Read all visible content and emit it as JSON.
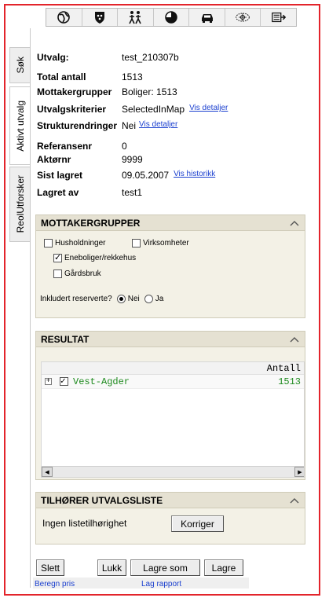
{
  "toolbar": {
    "icons": [
      "globe-icon",
      "shield-icon",
      "people-icon",
      "pie-chart-icon",
      "car-icon",
      "map-target-icon",
      "export-icon"
    ]
  },
  "tabs": [
    {
      "label": "Søk",
      "active": false
    },
    {
      "label": "Aktivt utvalg",
      "active": true
    },
    {
      "label": "ReolUtforsker",
      "active": false
    }
  ],
  "info": {
    "utvalg_label": "Utvalg:",
    "utvalg_value": "test_210307b",
    "total_label": "Total antall",
    "total_value": "1513",
    "mottaker_label": "Mottakergrupper",
    "mottaker_value": "Boliger: 1513",
    "kriterier_label": "Utvalgskriterier",
    "kriterier_value": "SelectedInMap",
    "kriterier_link": "Vis detaljer",
    "struktur_label": "Strukturendringer",
    "struktur_value": "Nei",
    "struktur_link": "Vis detaljer",
    "ref_label": "Referansenr",
    "ref_value": "0",
    "aktor_label": "Aktørnr",
    "aktor_value": "9999",
    "lagret_label": "Sist lagret",
    "lagret_value": "09.05.2007",
    "lagret_link": "Vis historikk",
    "lagretav_label": "Lagret av",
    "lagretav_value": "test1"
  },
  "mottakergrupper": {
    "title": "MOTTAKERGRUPPER",
    "husholdninger": {
      "label": "Husholdninger",
      "checked": false
    },
    "virksomheter": {
      "label": "Virksomheter",
      "checked": false
    },
    "eneboliger": {
      "label": "Eneboliger/rekkehus",
      "checked": true
    },
    "gardsbruk": {
      "label": "Gårdsbruk",
      "checked": false
    },
    "reserverte_label": "Inkludert reserverte?",
    "nei_label": "Nei",
    "ja_label": "Ja",
    "selected": "Nei"
  },
  "resultat": {
    "title": "RESULTAT",
    "column_header": "Antall",
    "rows": [
      {
        "name": "Vest-Agder",
        "count": "1513",
        "checked": true
      }
    ],
    "row_color": "#1e8a1e"
  },
  "utvalgsliste": {
    "title": "TILHØRER UTVALGSLISTE",
    "text": "Ingen listetilhørighet",
    "button": "Korriger"
  },
  "buttons": {
    "slett": "Slett",
    "lukk": "Lukk",
    "lagre_som": "Lagre som",
    "lagre": "Lagre"
  },
  "links": {
    "beregn_pris": "Beregn pris",
    "lag_rapport": "Lag rapport"
  },
  "colors": {
    "frame_border": "#e3242b",
    "panel_bg": "#f3f1e6",
    "panel_header": "#e5e1d2",
    "link": "#1a3fcf"
  }
}
